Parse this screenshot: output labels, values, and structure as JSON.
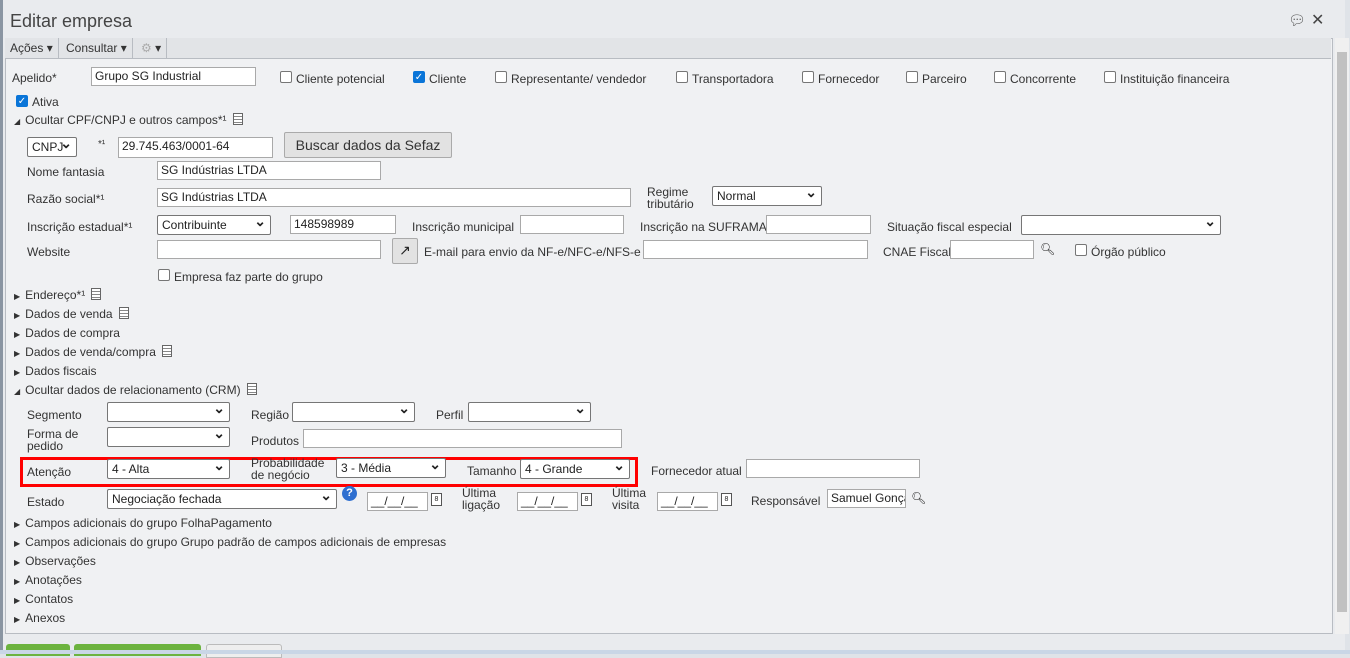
{
  "window": {
    "title": "Editar empresa"
  },
  "toolbar": {
    "acoes": "Ações",
    "consultar": "Consultar"
  },
  "top": {
    "apelido_label": "Apelido*",
    "apelido_value": "Grupo SG Industrial",
    "checks": [
      {
        "label": "Cliente potencial",
        "checked": false
      },
      {
        "label": "Cliente",
        "checked": true
      },
      {
        "label": "Representante/ vendedor",
        "checked": false
      },
      {
        "label": "Transportadora",
        "checked": false
      },
      {
        "label": "Fornecedor",
        "checked": false
      },
      {
        "label": "Parceiro",
        "checked": false
      },
      {
        "label": "Concorrente",
        "checked": false
      },
      {
        "label": "Instituição financeira",
        "checked": false
      }
    ],
    "ativa": "Ativa"
  },
  "doc_section": {
    "title": "Ocultar CPF/CNPJ e outros campos*¹",
    "doc_type": "CNPJ",
    "req": "*¹",
    "cnpj": "29.745.463/0001-64",
    "buscar": "Buscar dados da Sefaz",
    "nome_fantasia_label": "Nome fantasia",
    "nome_fantasia": "SG Indústrias LTDA",
    "razao_label": "Razão social*¹",
    "razao": "SG Indústrias LTDA",
    "regime_label1": "Regime",
    "regime_label2": "tributário",
    "regime": "Normal",
    "ie_label": "Inscrição estadual*¹",
    "ie_type": "Contribuinte",
    "ie": "148598989",
    "im_label": "Inscrição municipal",
    "suframa_label": "Inscrição na SUFRAMA",
    "sit_label": "Situação fiscal especial",
    "website_label": "Website",
    "email_label": "E-mail para envio da NF-e/NFC-e/NFS-e",
    "cnae_label": "CNAE Fiscal",
    "orgao_label": "Órgão público",
    "grupo_label": "Empresa faz parte do grupo"
  },
  "sections": [
    "Endereço*¹",
    "Dados de venda",
    "Dados de compra",
    "Dados de venda/compra",
    "Dados fiscais"
  ],
  "crm": {
    "title": "Ocultar dados de relacionamento (CRM)",
    "segmento": "Segmento",
    "regiao": "Região",
    "perfil": "Perfil",
    "forma1": "Forma de",
    "forma2": "pedido",
    "produtos": "Produtos",
    "atencao_label": "Atenção",
    "atencao": "4 - Alta",
    "prob1": "Probabilidade",
    "prob2": "de negócio",
    "prob": "3 - Média",
    "tamanho_label": "Tamanho",
    "tamanho": "4 - Grande",
    "fornecedor_label": "Fornecedor atual",
    "estado_label": "Estado",
    "estado": "Negociação fechada",
    "date_placeholder": "__/__/__",
    "ult_lig1": "Última",
    "ult_lig2": "ligação",
    "ult_vis1": "Última",
    "ult_vis2": "visita",
    "resp_label": "Responsável",
    "resp": "Samuel Gonçalves"
  },
  "sections2": [
    "Campos adicionais do grupo FolhaPagamento",
    "Campos adicionais do grupo Grupo padrão de campos adicionais de empresas",
    "Observações",
    "Anotações",
    "Contatos",
    "Anexos"
  ],
  "colors": {
    "highlight": "#ff0000",
    "accent": "#0a75d8",
    "green": "#6cb33f"
  }
}
